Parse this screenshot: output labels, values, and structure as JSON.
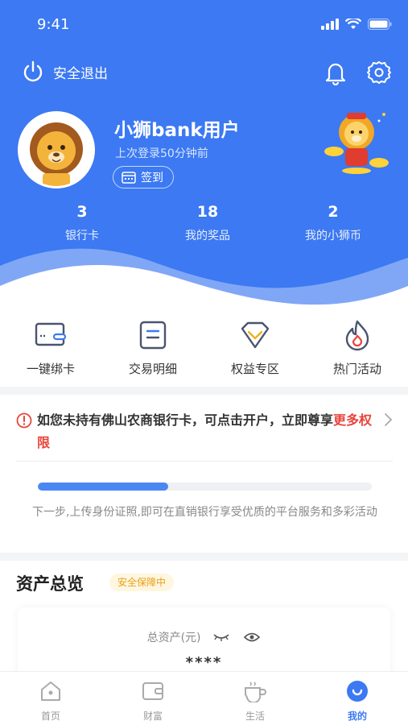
{
  "status_bar": {
    "time": "9:41"
  },
  "header": {
    "logout_label": "安全退出",
    "username": "小狮bank用户",
    "last_login": "上次登录50分钟前",
    "checkin_label": "签到",
    "stats": [
      {
        "value": "3",
        "label": "银行卡"
      },
      {
        "value": "18",
        "label": "我的奖品"
      },
      {
        "value": "2",
        "label": "我的小狮币"
      }
    ]
  },
  "quick_actions": [
    {
      "label": "一键绑卡",
      "icon": "card-link-icon"
    },
    {
      "label": "交易明细",
      "icon": "list-icon"
    },
    {
      "label": "权益专区",
      "icon": "diamond-icon"
    },
    {
      "label": "热门活动",
      "icon": "flame-icon"
    }
  ],
  "notice": {
    "text_main": "如您未持有佛山农商银行卡，可点击开户，立即尊享",
    "text_highlight": "更多权限",
    "progress_percent": 39,
    "next_step": "下一步,上传身份证照,即可在直销银行享受优质的平台服务和多彩活动"
  },
  "assets": {
    "title": "资产总览",
    "badge": "安全保障中",
    "total_label": "总资产(元)",
    "total_value": "****"
  },
  "tabbar": [
    {
      "label": "首页",
      "icon": "home-icon"
    },
    {
      "label": "财富",
      "icon": "wallet-icon"
    },
    {
      "label": "生活",
      "icon": "coffee-icon"
    },
    {
      "label": "我的",
      "icon": "profile-icon",
      "active": true
    }
  ],
  "colors": {
    "primary": "#3c79f2",
    "highlight_red": "#e8443a",
    "badge_orange": "#e7a11a"
  }
}
